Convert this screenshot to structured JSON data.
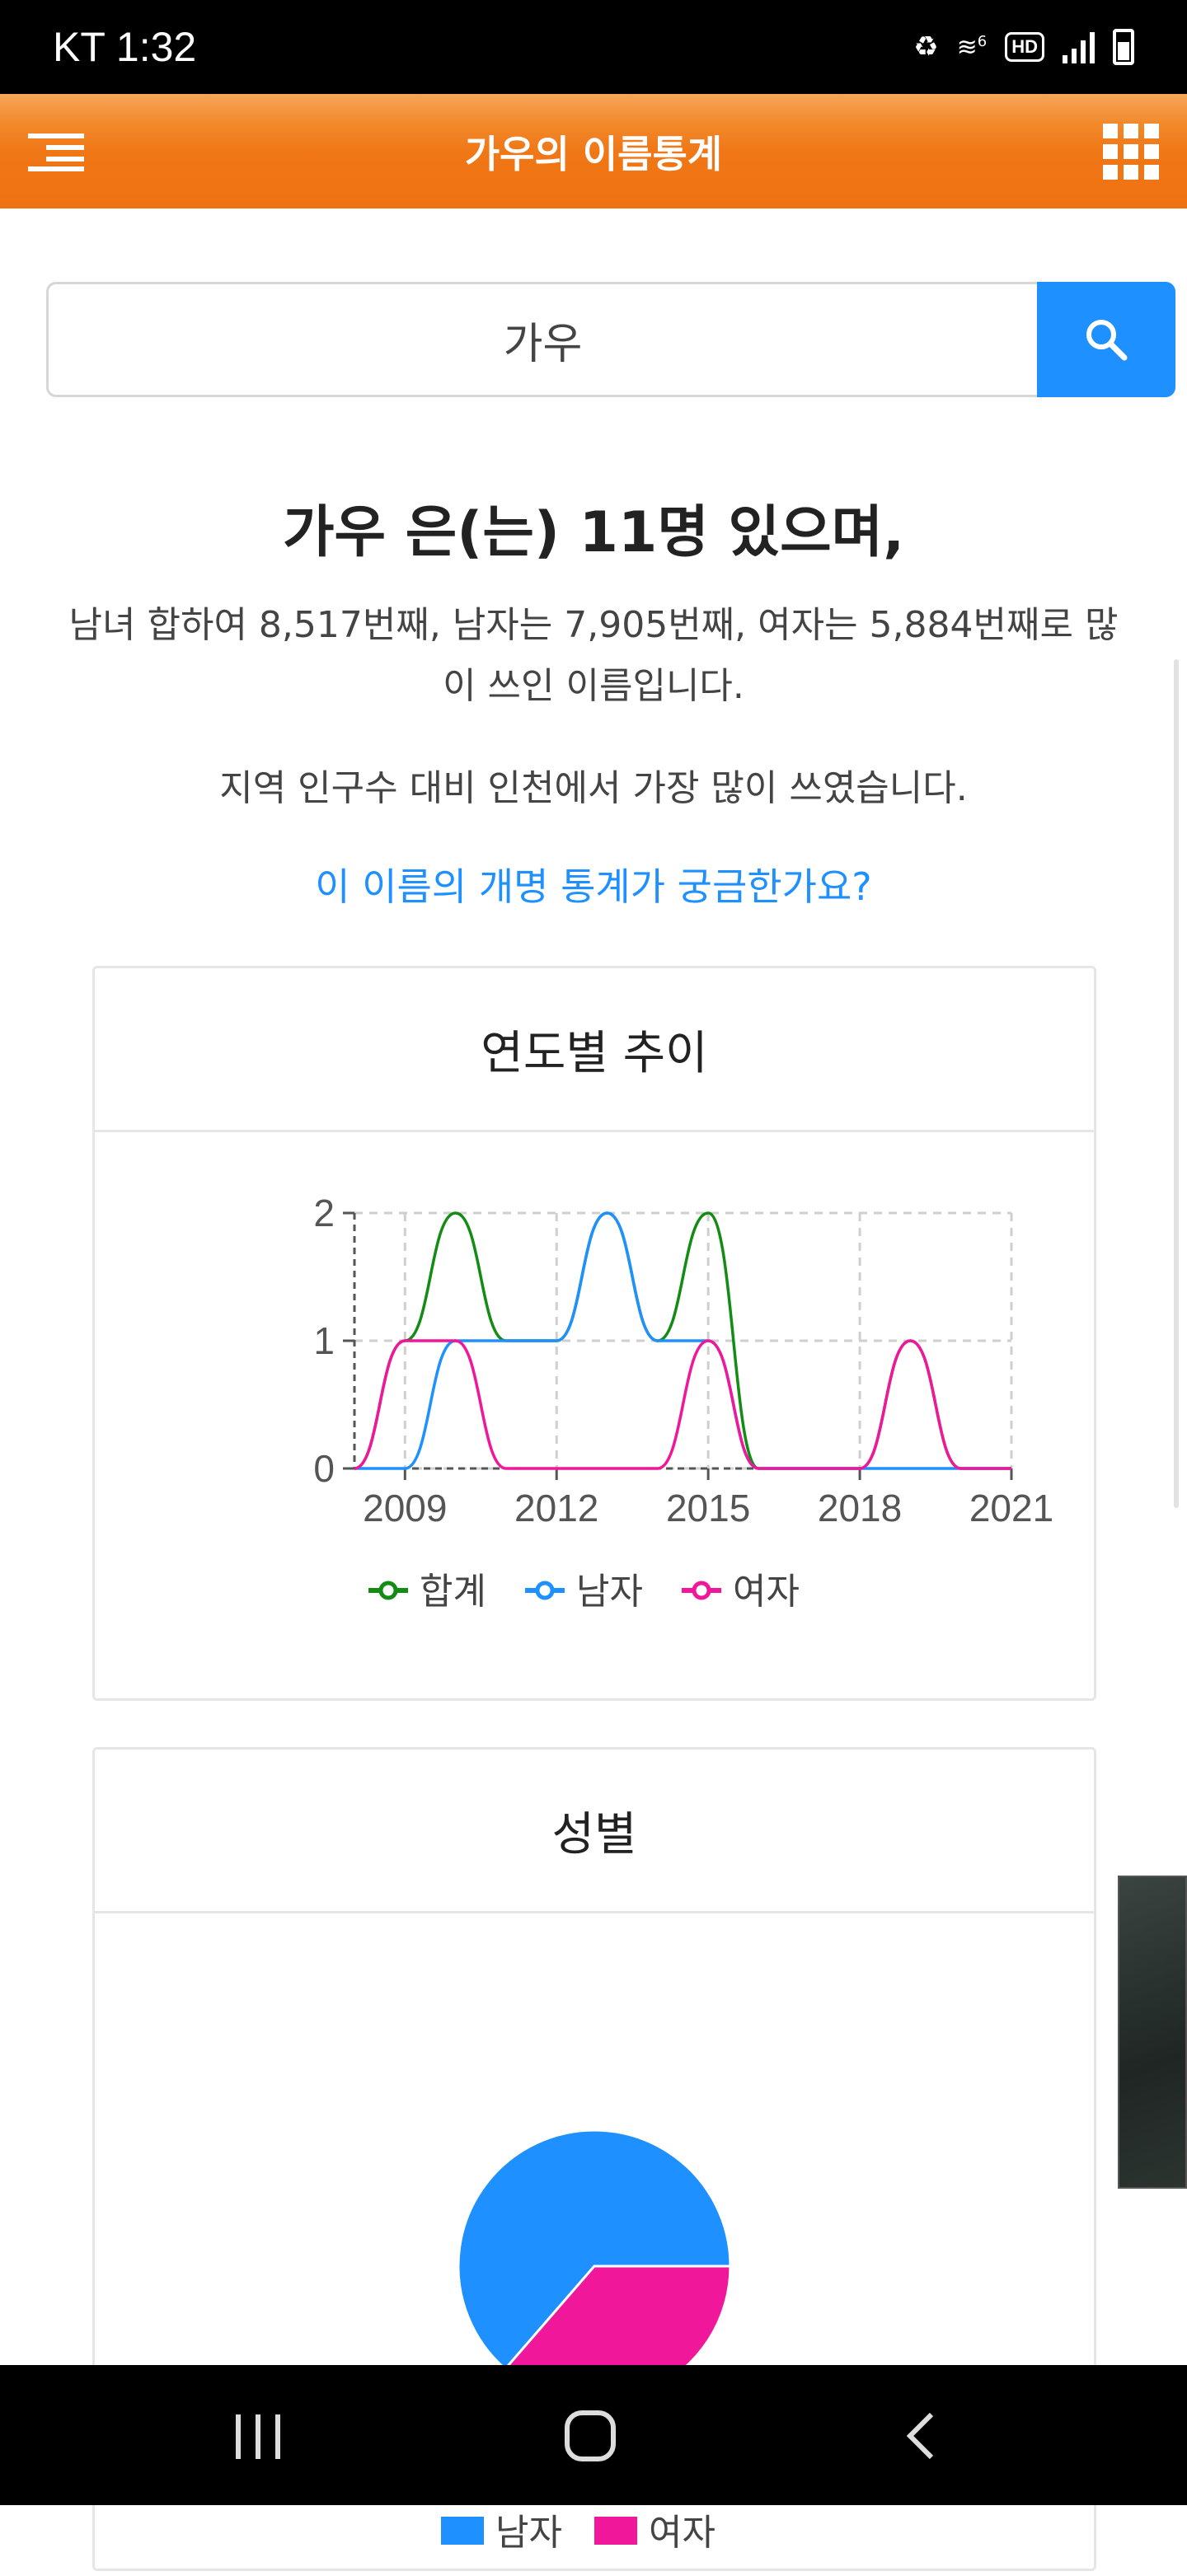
{
  "status_bar": {
    "carrier_time": "KT 1:32",
    "hd": "HD",
    "wifi_tag": "6"
  },
  "header": {
    "title": "가우의 이름통계"
  },
  "search": {
    "value": "가우"
  },
  "summary": {
    "headline": "가우 은(는) 11명 있으며,",
    "ranking": "남녀 합하여 8,517번째, 남자는 7,905번째, 여자는 5,884번째로 많이 쓰인 이름입니다.",
    "region": "지역 인구수 대비 인천에서 가장 많이 쓰였습니다.",
    "rename_link": "이 이름의 개명 통계가 궁금한가요?"
  },
  "trend_card": {
    "title": "연도별 추이"
  },
  "gender_card": {
    "title": "성별"
  },
  "colors": {
    "accent": "#ef7212",
    "link": "#1e90ff",
    "total": "#138c13",
    "male": "#1e90ff",
    "female": "#f0179a"
  },
  "chart_data": [
    {
      "type": "line",
      "x": [
        2008,
        2009,
        2010,
        2011,
        2012,
        2013,
        2014,
        2015,
        2016,
        2017,
        2018,
        2019,
        2020,
        2021
      ],
      "x_ticks": [
        "2009",
        "2012",
        "2015",
        "2018",
        "2021"
      ],
      "y_ticks": [
        "0",
        "1",
        "2"
      ],
      "ylim": [
        0,
        2
      ],
      "grid": true,
      "legend_position": "bottom",
      "series": [
        {
          "name": "합계",
          "color": "#138c13",
          "values": [
            0,
            1,
            2,
            1,
            1,
            2,
            1,
            2,
            0,
            0,
            0,
            1,
            0,
            0
          ]
        },
        {
          "name": "남자",
          "color": "#1e90ff",
          "values": [
            0,
            0,
            1,
            1,
            1,
            2,
            1,
            1,
            0,
            0,
            0,
            0,
            0,
            0
          ]
        },
        {
          "name": "여자",
          "color": "#f0179a",
          "values": [
            0,
            1,
            1,
            0,
            0,
            0,
            0,
            1,
            0,
            0,
            0,
            1,
            0,
            0
          ]
        }
      ]
    },
    {
      "type": "pie",
      "categories": [
        "남자",
        "여자"
      ],
      "values": [
        7,
        4
      ],
      "colors": [
        "#1e90ff",
        "#f0179a"
      ],
      "legend_position": "bottom"
    }
  ]
}
